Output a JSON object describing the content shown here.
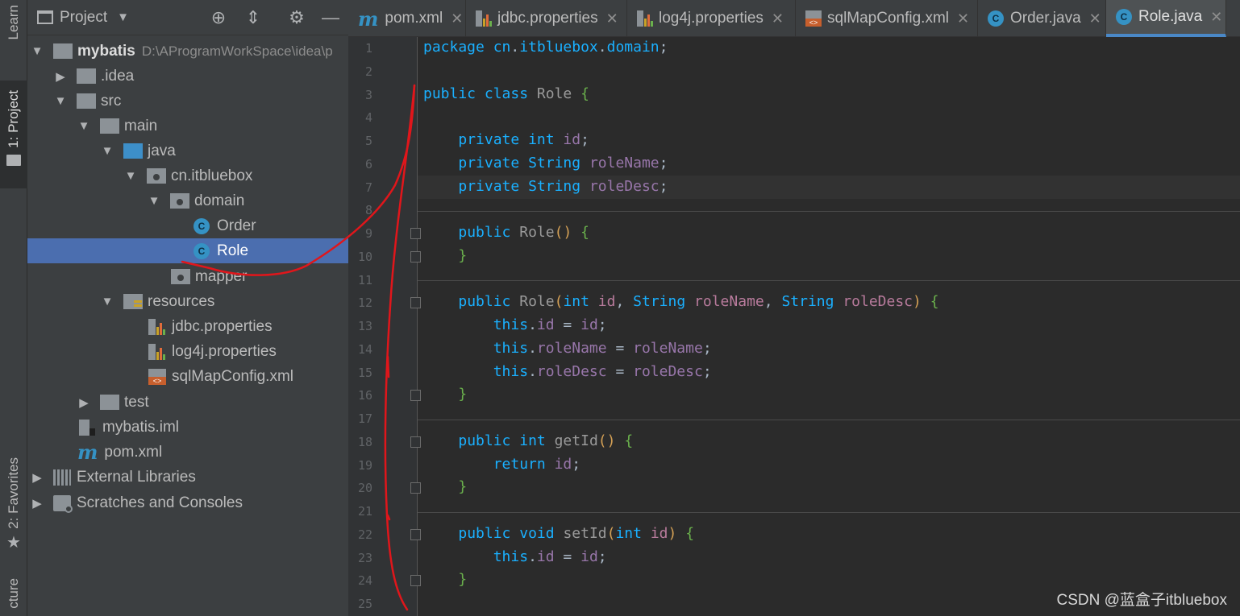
{
  "sidebar_left": {
    "learn": "Learn",
    "project": "1: Project",
    "favorites": "2: Favorites",
    "structure": "cture"
  },
  "project_panel": {
    "title": "Project",
    "tree": [
      {
        "label": "mybatis",
        "path": "D:\\AProgramWorkSpace\\idea\\p"
      },
      {
        "label": ".idea"
      },
      {
        "label": "src"
      },
      {
        "label": "main"
      },
      {
        "label": "java"
      },
      {
        "label": "cn.itbluebox"
      },
      {
        "label": "domain"
      },
      {
        "label": "Order"
      },
      {
        "label": "Role"
      },
      {
        "label": "mapper"
      },
      {
        "label": "resources"
      },
      {
        "label": "jdbc.properties"
      },
      {
        "label": "log4j.properties"
      },
      {
        "label": "sqlMapConfig.xml"
      },
      {
        "label": "test"
      },
      {
        "label": "mybatis.iml"
      },
      {
        "label": "pom.xml"
      },
      {
        "label": "External Libraries"
      },
      {
        "label": "Scratches and Consoles"
      }
    ]
  },
  "tabs": [
    {
      "label": "pom.xml",
      "icon": "maven-icon"
    },
    {
      "label": "jdbc.properties",
      "icon": "properties-icon"
    },
    {
      "label": "log4j.properties",
      "icon": "properties-icon"
    },
    {
      "label": "sqlMapConfig.xml",
      "icon": "xml-icon"
    },
    {
      "label": "Order.java",
      "icon": "class-icon"
    },
    {
      "label": "Role.java",
      "icon": "class-icon",
      "active": true
    }
  ],
  "editor": {
    "line_numbers": [
      "1",
      "2",
      "3",
      "4",
      "5",
      "6",
      "7",
      "8",
      "9",
      "10",
      "11",
      "12",
      "13",
      "14",
      "15",
      "16",
      "17",
      "18",
      "19",
      "20",
      "21",
      "22",
      "23",
      "24",
      "25"
    ],
    "lines": [
      "package cn.itbluebox.domain;",
      "",
      "public class Role {",
      "",
      "    private int id;",
      "    private String roleName;",
      "    private String roleDesc;",
      "",
      "    public Role() {",
      "    }",
      "",
      "    public Role(int id, String roleName, String roleDesc) {",
      "        this.id = id;",
      "        this.roleName = roleName;",
      "        this.roleDesc = roleDesc;",
      "    }",
      "",
      "    public int getId() {",
      "        return id;",
      "    }",
      "",
      "    public void setId(int id) {",
      "        this.id = id;",
      "    }",
      ""
    ]
  },
  "watermark": "CSDN @蓝盒子itbluebox",
  "colors": {
    "panel_bg": "#3c3f41",
    "editor_bg": "#2b2b2b",
    "selection": "#4b6eaf",
    "keyword": "#1ab0ff",
    "field": "#9876aa",
    "annotation_stroke": "#e0161b"
  }
}
